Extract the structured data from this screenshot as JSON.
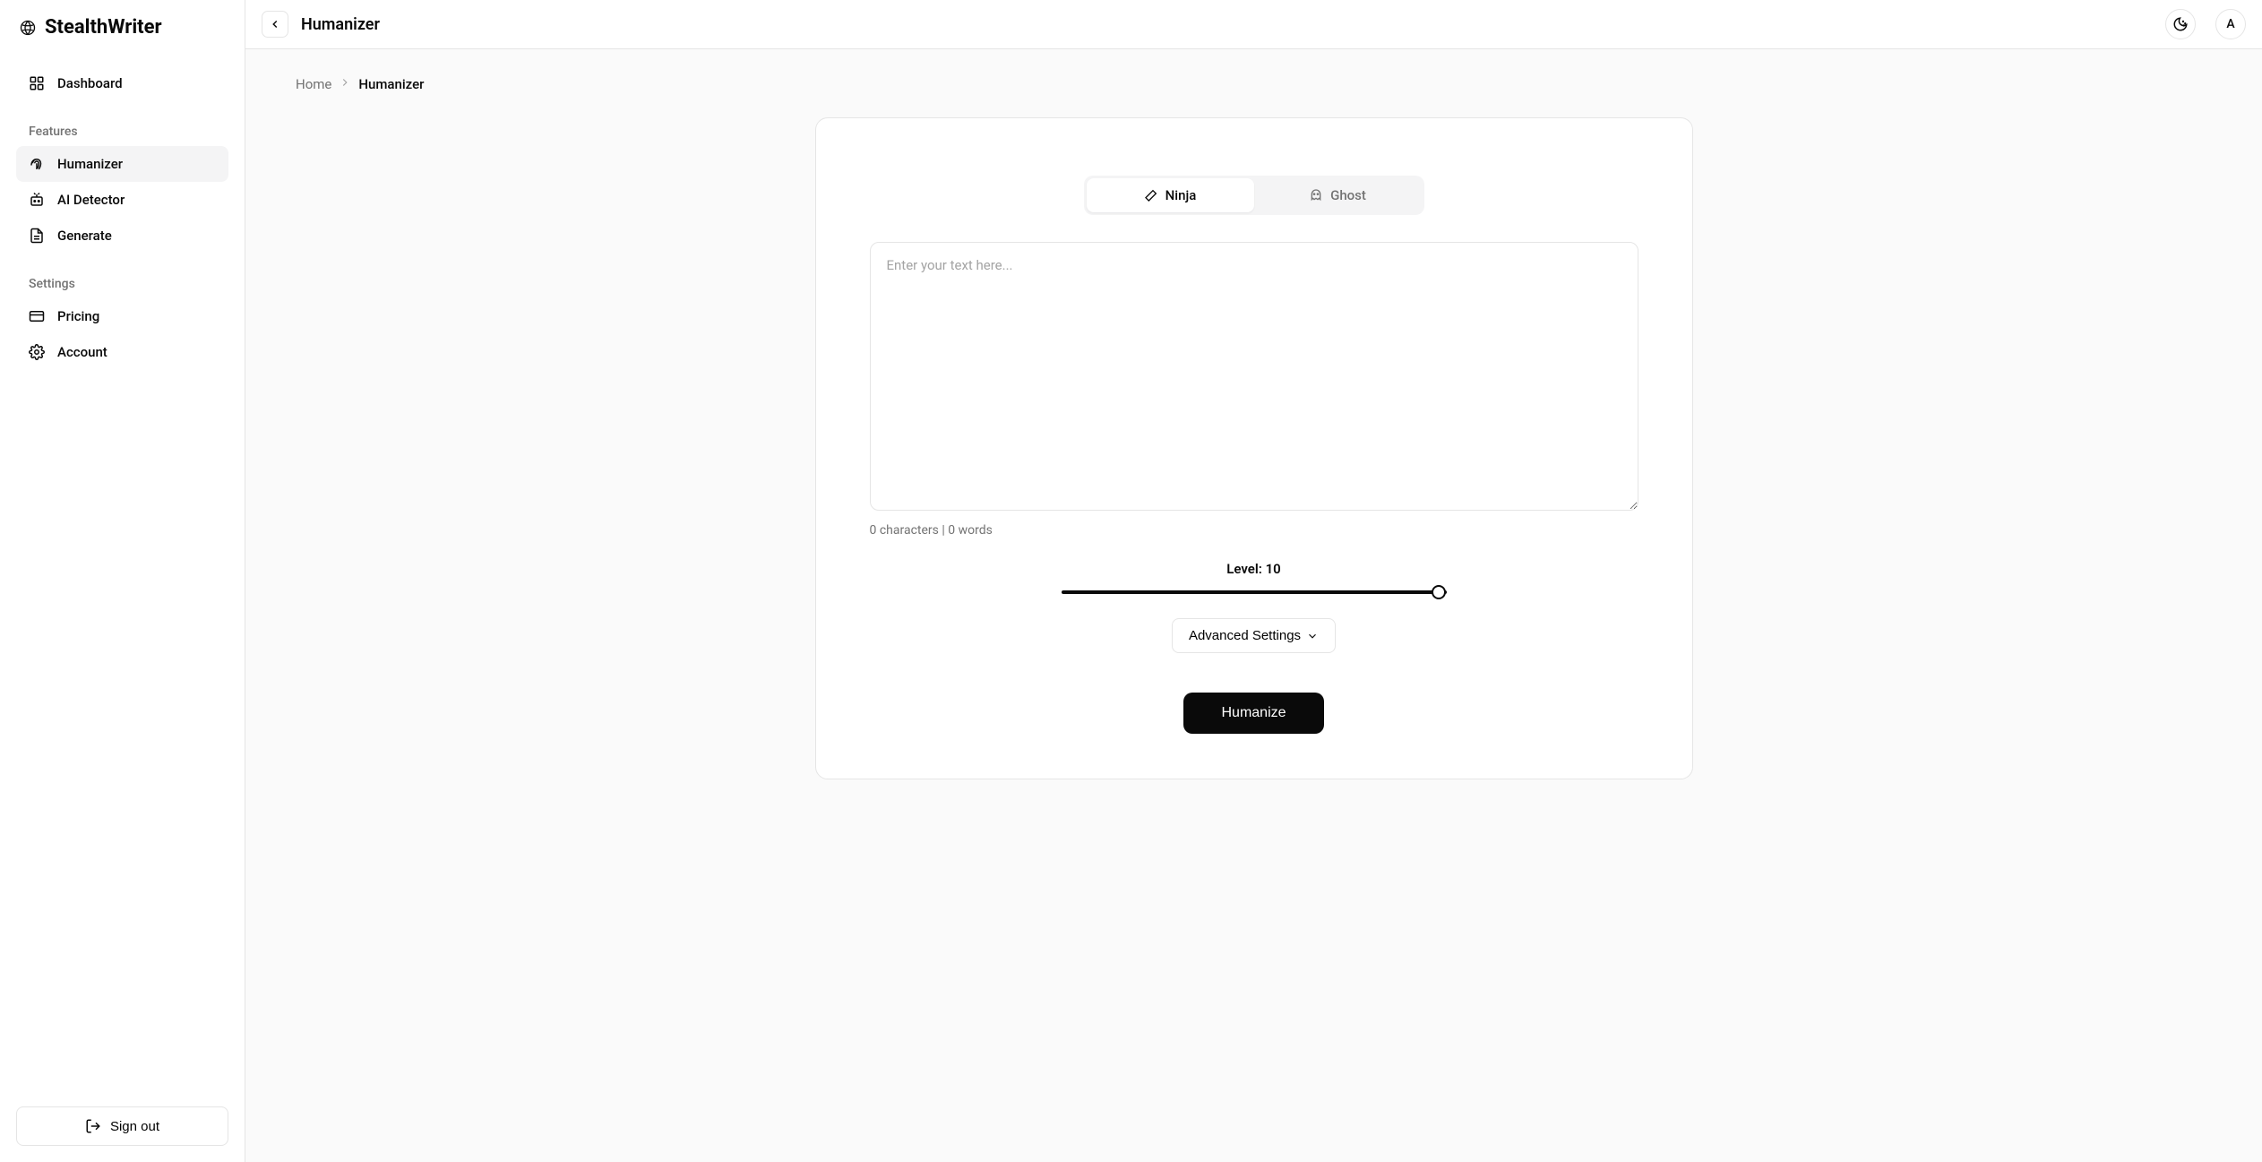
{
  "brand": {
    "name": "StealthWriter"
  },
  "sidebar": {
    "items": [
      "Dashboard"
    ],
    "features_heading": "Features",
    "features": [
      "Humanizer",
      "AI Detector",
      "Generate"
    ],
    "settings_heading": "Settings",
    "settings": [
      "Pricing",
      "Account"
    ],
    "signout": "Sign out"
  },
  "header": {
    "title": "Humanizer",
    "avatar_initial": "A"
  },
  "breadcrumb": {
    "home": "Home",
    "current": "Humanizer"
  },
  "editor": {
    "tabs": {
      "ninja": "Ninja",
      "ghost": "Ghost"
    },
    "placeholder": "Enter your text here...",
    "text_value": "",
    "char_count": 0,
    "word_count": 0,
    "count_suffix_chars": " characters | ",
    "count_suffix_words": " words",
    "level_prefix": "Level: ",
    "level_value": 10,
    "level_max": 10,
    "advanced": "Advanced Settings",
    "humanize": "Humanize"
  }
}
